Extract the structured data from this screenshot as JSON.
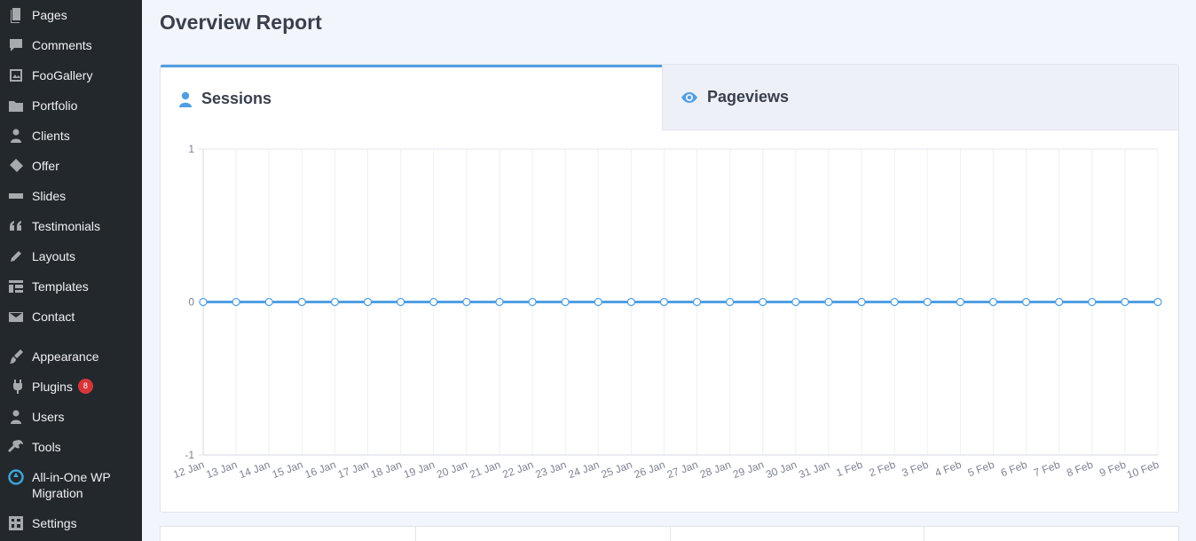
{
  "sidebar": {
    "items": [
      {
        "label": "Pages",
        "icon": "pages-icon"
      },
      {
        "label": "Comments",
        "icon": "comments-icon"
      },
      {
        "label": "FooGallery",
        "icon": "gallery-icon"
      },
      {
        "label": "Portfolio",
        "icon": "folder-icon"
      },
      {
        "label": "Clients",
        "icon": "clients-icon"
      },
      {
        "label": "Offer",
        "icon": "offer-icon"
      },
      {
        "label": "Slides",
        "icon": "slides-icon"
      },
      {
        "label": "Testimonials",
        "icon": "quote-icon"
      },
      {
        "label": "Layouts",
        "icon": "pencil-icon"
      },
      {
        "label": "Templates",
        "icon": "templates-icon"
      },
      {
        "label": "Contact",
        "icon": "envelope-icon"
      },
      {
        "label": "Appearance",
        "icon": "brush-icon"
      },
      {
        "label": "Plugins",
        "icon": "plugin-icon",
        "badge": "8"
      },
      {
        "label": "Users",
        "icon": "user-icon"
      },
      {
        "label": "Tools",
        "icon": "wrench-icon"
      },
      {
        "label": "All-in-One WP Migration",
        "icon": "migration-icon"
      },
      {
        "label": "Settings",
        "icon": "settings-icon"
      }
    ]
  },
  "main": {
    "title": "Overview Report",
    "tabs": [
      {
        "label": "Sessions",
        "icon": "user-icon",
        "active": true
      },
      {
        "label": "Pageviews",
        "icon": "eye-icon",
        "active": false
      }
    ]
  },
  "colors": {
    "accent": "#509fe2",
    "sidebar_bg": "#23282d",
    "badge": "#d63638"
  },
  "chart_data": {
    "type": "line",
    "x": [
      "12 Jan",
      "13 Jan",
      "14 Jan",
      "15 Jan",
      "16 Jan",
      "17 Jan",
      "18 Jan",
      "19 Jan",
      "20 Jan",
      "21 Jan",
      "22 Jan",
      "23 Jan",
      "24 Jan",
      "25 Jan",
      "26 Jan",
      "27 Jan",
      "28 Jan",
      "29 Jan",
      "30 Jan",
      "31 Jan",
      "1 Feb",
      "2 Feb",
      "3 Feb",
      "4 Feb",
      "5 Feb",
      "6 Feb",
      "7 Feb",
      "8 Feb",
      "9 Feb",
      "10 Feb"
    ],
    "series": [
      {
        "values": [
          0,
          0,
          0,
          0,
          0,
          0,
          0,
          0,
          0,
          0,
          0,
          0,
          0,
          0,
          0,
          0,
          0,
          0,
          0,
          0,
          0,
          0,
          0,
          0,
          0,
          0,
          0,
          0,
          0,
          0
        ]
      }
    ],
    "ylim": [
      -1,
      1
    ],
    "yticks": [
      "1",
      "0",
      "-1"
    ],
    "grid": true,
    "legend": "none"
  }
}
